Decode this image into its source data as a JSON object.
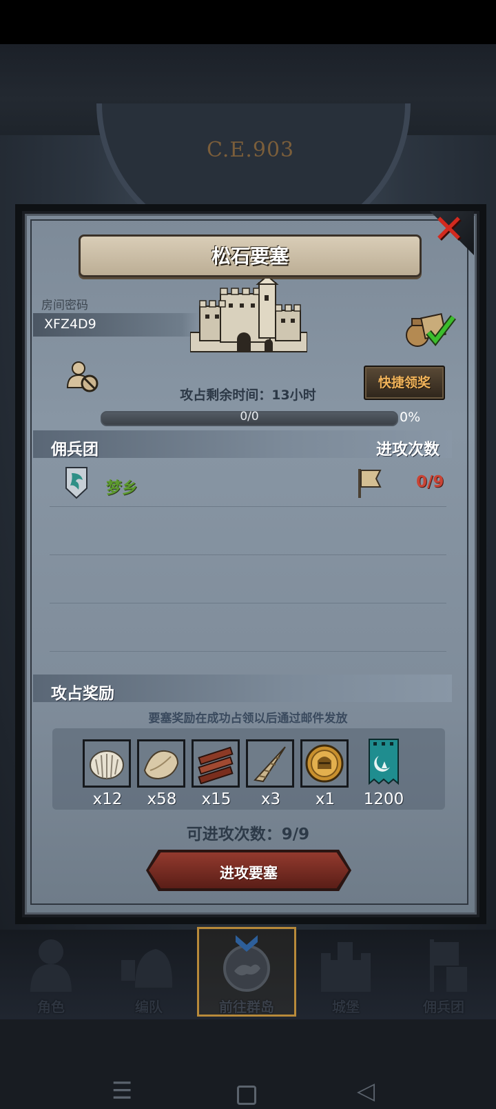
{
  "header": {
    "era": "C.E.903"
  },
  "fortress": {
    "title": "松石要塞",
    "room_code_label": "房间密码",
    "room_code": "XFZ4D9",
    "quick_claim_label": "快捷领奖",
    "timer_text": "攻占剩余时间：13小时",
    "progress_text": "0/0",
    "progress_percent_text": "0%",
    "progress_fraction": 0
  },
  "mercenary_section": {
    "title": "佣兵团",
    "attack_count_title": "进攻次数",
    "guilds": [
      {
        "name": "梦乡",
        "attempts": "0/9"
      }
    ]
  },
  "rewards_section": {
    "title": "攻占奖励",
    "note": "要塞奖励在成功占领以后通过邮件发放",
    "items": [
      {
        "icon": "shell-icon",
        "count": "x12"
      },
      {
        "icon": "fur-icon",
        "count": "x58"
      },
      {
        "icon": "wood-planks-icon",
        "count": "x15"
      },
      {
        "icon": "horn-icon",
        "count": "x3"
      },
      {
        "icon": "knight-medal-icon",
        "count": "x1"
      },
      {
        "icon": "guild-banner-icon",
        "count": "1200"
      }
    ],
    "remaining_attacks": "可进攻次数：9/9",
    "attack_button_label": "进攻要塞"
  },
  "bottom_nav": {
    "tabs": [
      {
        "label": "角色",
        "icon": "character-icon"
      },
      {
        "label": "编队",
        "icon": "formation-icon"
      },
      {
        "label": "前往群岛",
        "icon": "islands-icon",
        "active": true
      },
      {
        "label": "城堡",
        "icon": "castle-icon"
      },
      {
        "label": "佣兵团",
        "icon": "mercenary-icon"
      }
    ]
  },
  "colors": {
    "accent_gold": "#b88a3a",
    "attack_red": "#933a2e",
    "attempt_red": "#c94334",
    "guild_green": "#5c9a2e"
  }
}
